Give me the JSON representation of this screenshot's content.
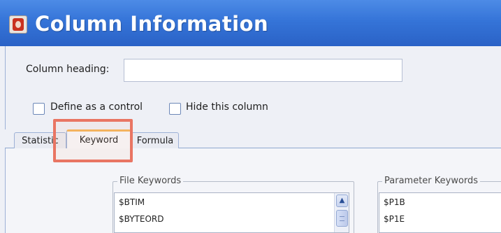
{
  "window": {
    "title": "Column Information",
    "app_icon": "application-icon"
  },
  "form": {
    "column_heading_label": "Column heading:",
    "column_heading_value": "",
    "define_control_label": "Define as a control",
    "define_control_checked": false,
    "hide_column_label": "Hide this column",
    "hide_column_checked": false
  },
  "tabs": [
    {
      "label": "Statistic",
      "active": false
    },
    {
      "label": "Keyword",
      "active": true
    },
    {
      "label": "Formula",
      "active": false
    }
  ],
  "file_keywords": {
    "title": "File Keywords",
    "items": [
      "$BTIM",
      "$BYTEORD"
    ]
  },
  "parameter_keywords": {
    "title": "Parameter Keywords",
    "items": [
      "$P1B",
      "$P1E"
    ]
  },
  "colors": {
    "title_bar": "#3574d8",
    "highlight_box": "#e97563",
    "active_tab_accent": "#f4b459"
  }
}
